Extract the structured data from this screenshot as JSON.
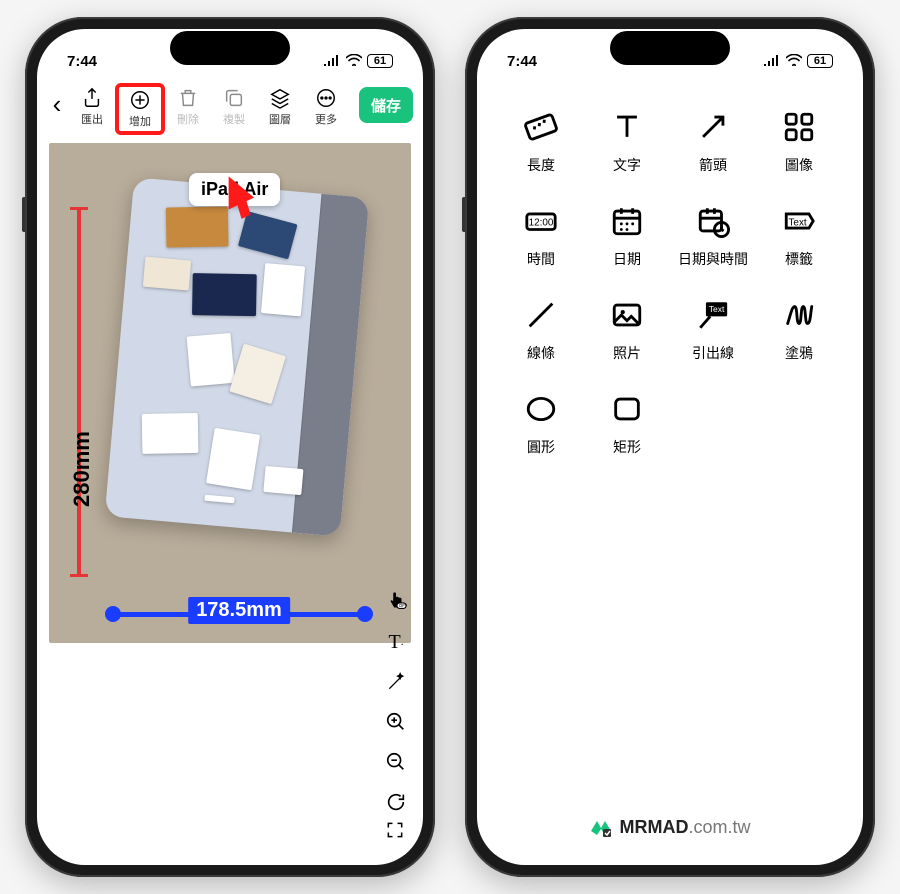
{
  "status": {
    "time": "7:44",
    "battery": "61"
  },
  "phone1": {
    "toolbar": {
      "export": "匯出",
      "add": "增加",
      "delete": "刪除",
      "duplicate": "複製",
      "layers": "圖層",
      "more": "更多",
      "save": "儲存"
    },
    "canvas": {
      "label": "iPad Air",
      "dim_v": "280mm",
      "dim_h": "178.5mm"
    }
  },
  "phone2": {
    "tools": {
      "length": "長度",
      "text": "文字",
      "arrow": "箭頭",
      "image": "圖像",
      "time": "時間",
      "time_sample": "12:00",
      "date": "日期",
      "datetime": "日期與時間",
      "tag": "標籤",
      "tag_sample": "Text",
      "line": "線條",
      "photo": "照片",
      "callout": "引出線",
      "callout_sample": "Text",
      "scribble": "塗鴉",
      "circle": "圓形",
      "rect": "矩形"
    }
  },
  "watermark": {
    "brand": "MRMAD",
    "suffix": ".com.tw"
  },
  "accent": "#19c37d"
}
